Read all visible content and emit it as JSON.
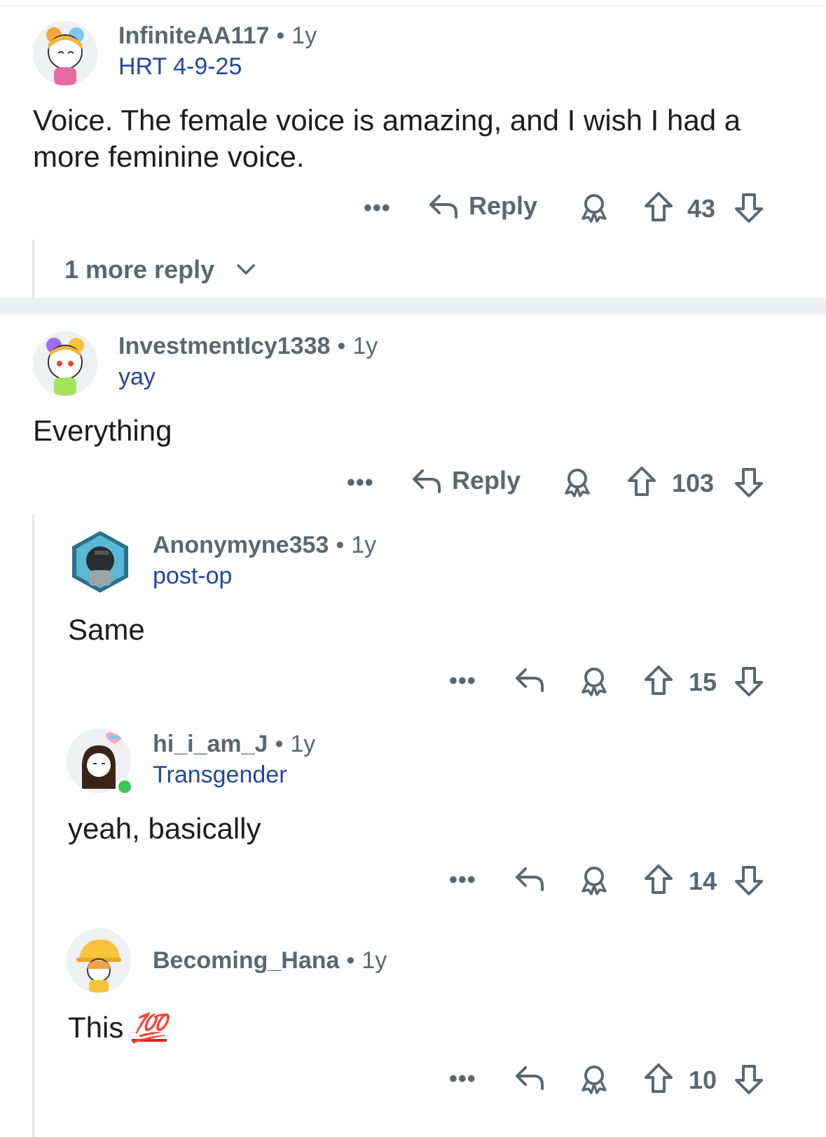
{
  "comments": [
    {
      "username": "InfiniteAA117",
      "age": "1y",
      "flair": "HRT 4-9-25",
      "body": "Voice. The female voice is amazing, and I wish I had a more feminine voice.",
      "reply_label": "Reply",
      "score": "43",
      "more_replies": "1 more reply"
    },
    {
      "username": "InvestmentIcy1338",
      "age": "1y",
      "flair": "yay",
      "body": "Everything",
      "reply_label": "Reply",
      "score": "103"
    },
    {
      "username": "Anonymyne353",
      "age": "1y",
      "flair": "post-op",
      "body": "Same",
      "score": "15"
    },
    {
      "username": "hi_i_am_J",
      "age": "1y",
      "flair": "Transgender",
      "body": "yeah, basically",
      "score": "14"
    },
    {
      "username": "Becoming_Hana",
      "age": "1y",
      "body": "This",
      "emoji": "💯",
      "score": "10"
    }
  ],
  "dot_separator": "•",
  "overflow_label": "•••",
  "icons": {
    "overflow": "ellipsis-icon",
    "reply": "reply-arrow-icon",
    "award": "award-icon",
    "upvote": "upvote-arrow-icon",
    "downvote": "downvote-arrow-icon",
    "expand": "chevron-down-icon"
  },
  "colors": {
    "meta_text": "#5b6770",
    "flair_text": "#25479a",
    "body_text": "#1c1c1c",
    "online": "#3ec55a",
    "emoji_100": "#d8202a"
  }
}
